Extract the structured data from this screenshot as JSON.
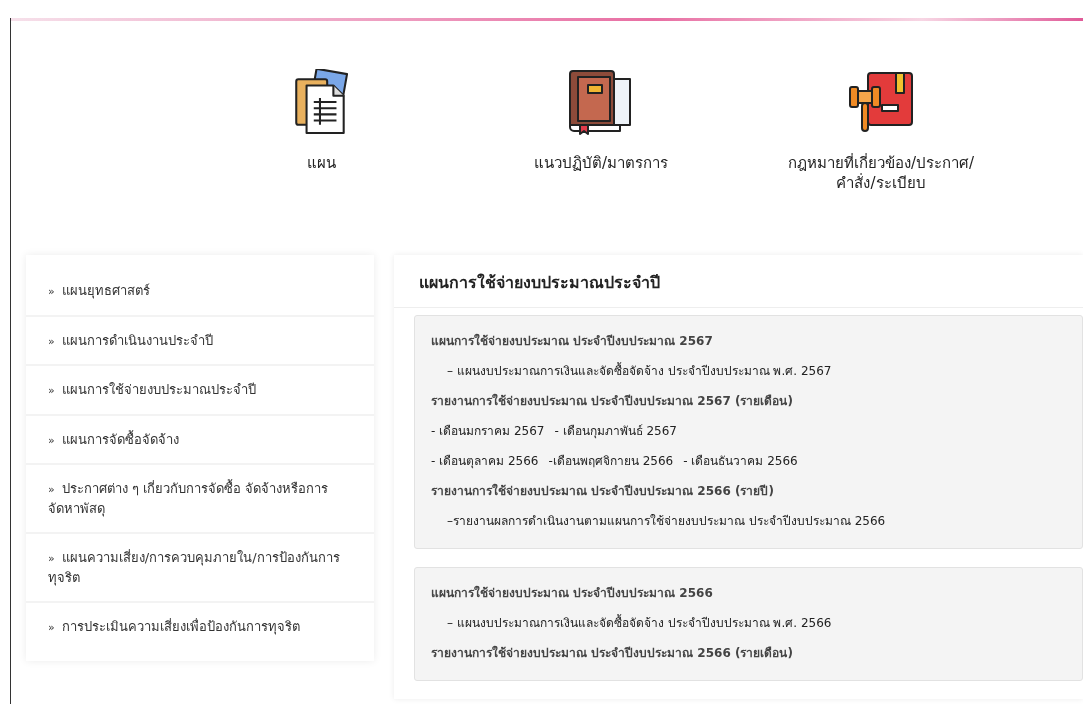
{
  "categories": [
    {
      "kind": "documents",
      "label": "แผน"
    },
    {
      "kind": "book",
      "label": "แนวปฏิบัติ/มาตรการ"
    },
    {
      "kind": "law",
      "label": "กฎหมายที่เกี่ยวข้อง/ประกาศ/\nคำสั่ง/ระเบียบ"
    }
  ],
  "sidebar": {
    "marker": "»",
    "items": [
      {
        "label": "แผนยุทธศาสตร์"
      },
      {
        "label": "แผนการดำเนินงานประจำปี"
      },
      {
        "label": "แผนการใช้จ่ายงบประมาณประจำปี"
      },
      {
        "label": "แผนการจัดซื้อจัดจ้าง"
      },
      {
        "label": "ประกาศต่าง ๆ เกี่ยวกับการจัดซื้อ จัดจ้างหรือการจัดหาพัสดุ"
      },
      {
        "label": "แผนความเสี่ยง/การควบคุมภายใน/การป้องกันการทุจริต"
      },
      {
        "label": "การประเมินความเสี่ยงเพื่อป้องกันการทุจริต"
      }
    ]
  },
  "content": {
    "title": "แผนการใช้จ่ายงบประมาณประจำปี",
    "sections": [
      {
        "entries": [
          {
            "kind": "heading",
            "text": "แผนการใช้จ่ายงบประมาณ ประจำปีงบประมาณ 2567"
          },
          {
            "kind": "links",
            "indent": true,
            "items": [
              "– แผนงบประมาณการเงินและจัดซื้อจัดจ้าง ประจำปีงบประมาณ พ.ศ. 2567"
            ]
          },
          {
            "kind": "heading",
            "text": "รายงานการใช้จ่ายงบประมาณ ประจำปีงบประมาณ 2567 (รายเดือน)"
          },
          {
            "kind": "links",
            "indent": false,
            "items": [
              "- เดือนมกราคม 2567",
              "- เดือนกุมภาพันธ์ 2567"
            ]
          },
          {
            "kind": "links",
            "indent": false,
            "items": [
              "- เดือนตุลาคม 2566",
              "-เดือนพฤศจิกายน 2566",
              "- เดือนธันวาคม 2566"
            ]
          },
          {
            "kind": "heading",
            "text": "รายงานการใช้จ่ายงบประมาณ ประจำปีงบประมาณ 2566 (รายปี)"
          },
          {
            "kind": "links",
            "indent": true,
            "items": [
              "–รายงานผลการดำเนินงานตามแผนการใช้จ่ายงบประมาณ ประจำปีงบประมาณ 2566"
            ]
          }
        ]
      },
      {
        "entries": [
          {
            "kind": "heading",
            "text": "แผนการใช้จ่ายงบประมาณ ประจำปีงบประมาณ 2566"
          },
          {
            "kind": "links",
            "indent": true,
            "items": [
              "– แผนงบประมาณการเงินและจัดซื้อจัดจ้าง ประจำปีงบประมาณ พ.ศ. 2566"
            ]
          },
          {
            "kind": "heading",
            "text": "รายงานการใช้จ่ายงบประมาณ ประจำปีงบประมาณ 2566 (รายเดือน)"
          }
        ]
      }
    ]
  }
}
